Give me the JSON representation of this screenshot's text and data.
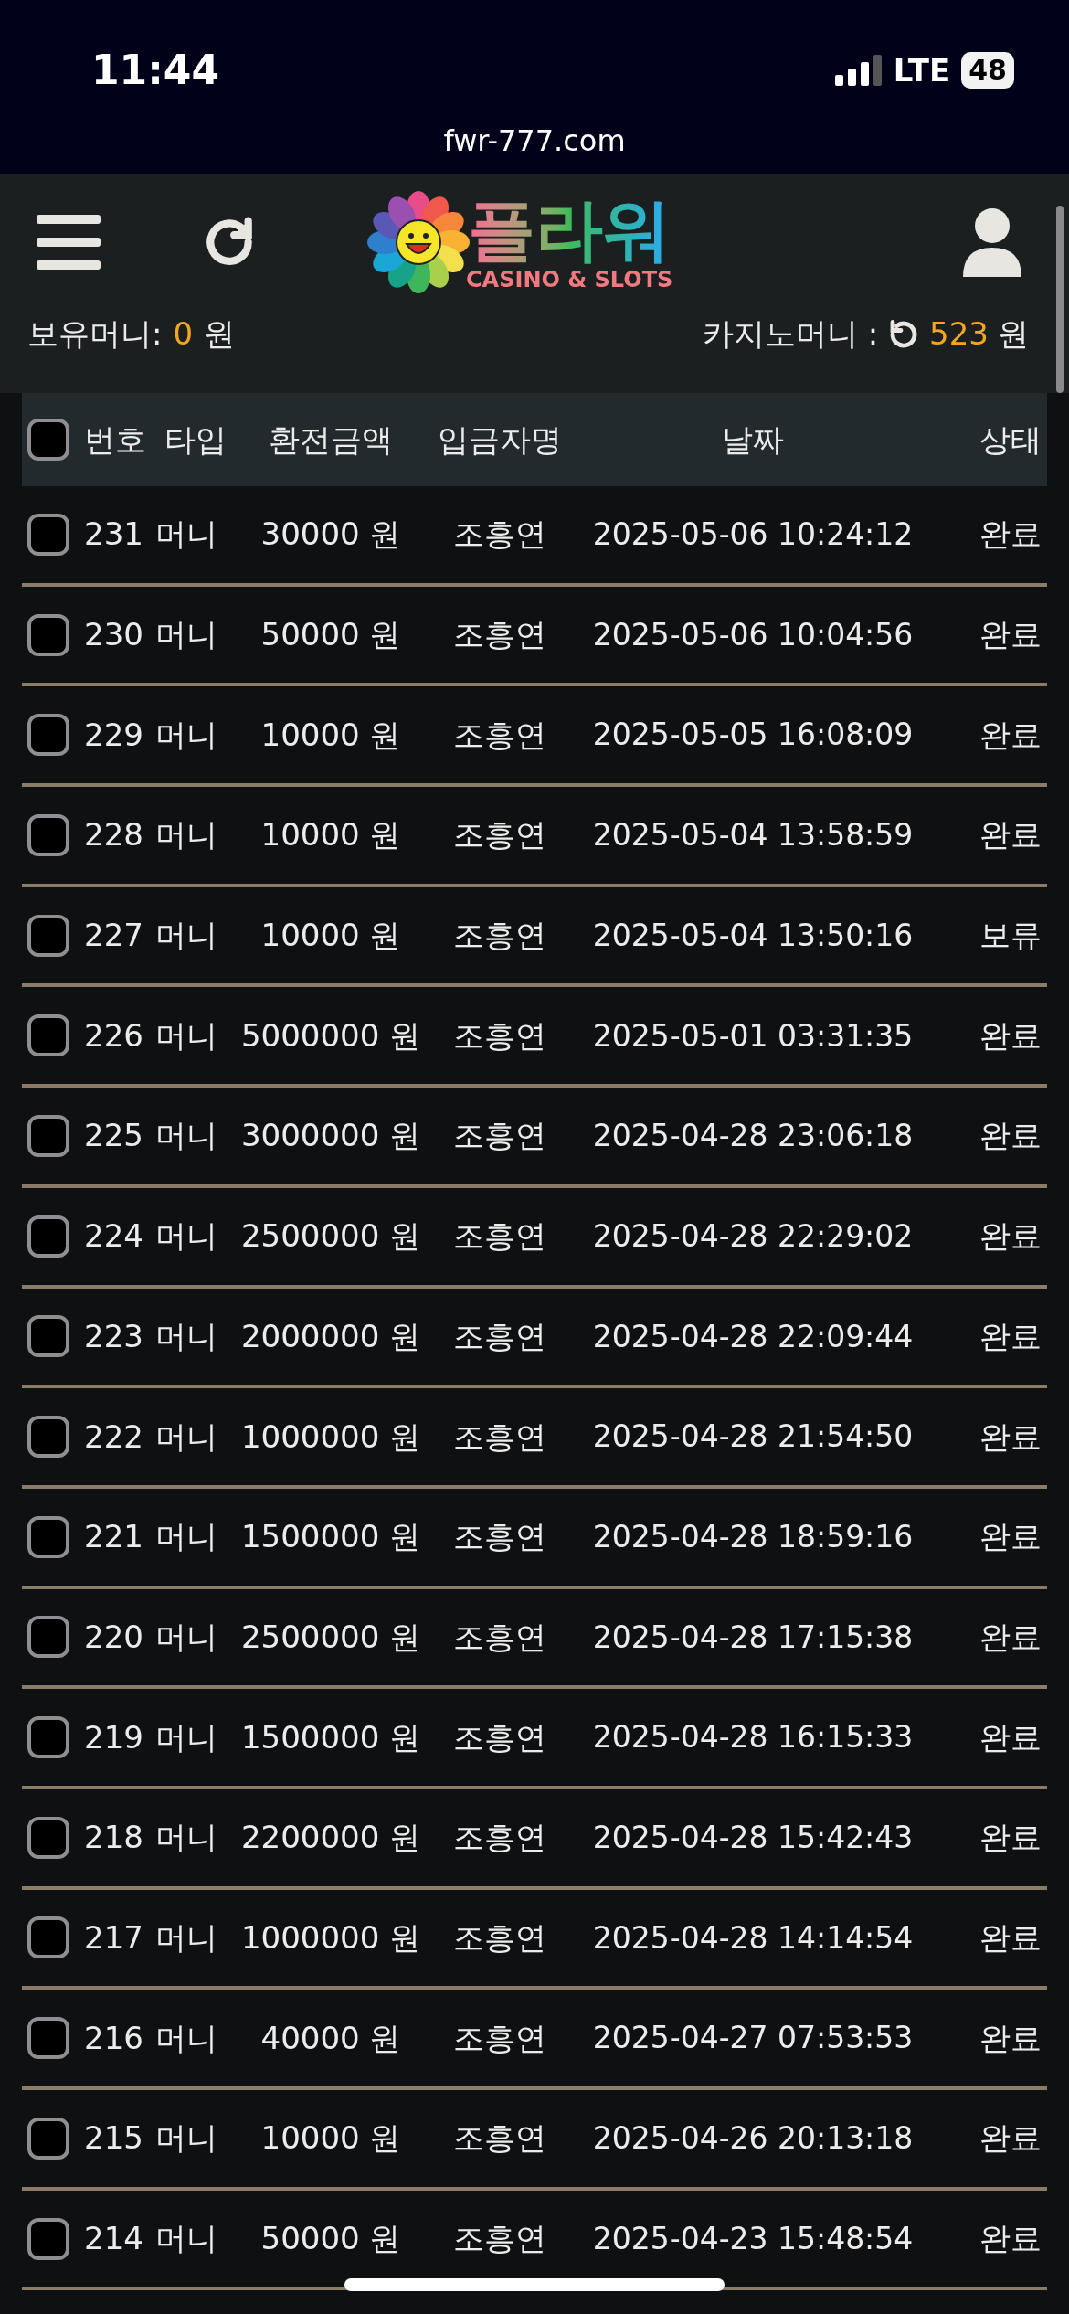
{
  "status_bar": {
    "time": "11:44",
    "network": "LTE",
    "battery": "48"
  },
  "browser": {
    "url": "fwr-777.com"
  },
  "header": {
    "logo_title": "플라워",
    "logo_subtitle": "CASINO & SLOTS"
  },
  "balances": {
    "held_label": "보유머니:",
    "held_value": "0",
    "held_unit": "원",
    "casino_label": "카지노머니 :",
    "casino_value": "523",
    "casino_unit": "원"
  },
  "table": {
    "select_all": {
      "checked": false
    },
    "columns": [
      "번호",
      "타입",
      "환전금액",
      "입금자명",
      "날짜",
      "상태"
    ],
    "rows": [
      {
        "number": "231",
        "type": "머니",
        "amount": "30000 원",
        "name": "조흥연",
        "date": "2025-05-06 10:24:12",
        "status": "완료",
        "checked": false
      },
      {
        "number": "230",
        "type": "머니",
        "amount": "50000 원",
        "name": "조흥연",
        "date": "2025-05-06 10:04:56",
        "status": "완료",
        "checked": false
      },
      {
        "number": "229",
        "type": "머니",
        "amount": "10000 원",
        "name": "조흥연",
        "date": "2025-05-05 16:08:09",
        "status": "완료",
        "checked": false
      },
      {
        "number": "228",
        "type": "머니",
        "amount": "10000 원",
        "name": "조흥연",
        "date": "2025-05-04 13:58:59",
        "status": "완료",
        "checked": false
      },
      {
        "number": "227",
        "type": "머니",
        "amount": "10000 원",
        "name": "조흥연",
        "date": "2025-05-04 13:50:16",
        "status": "보류",
        "checked": false
      },
      {
        "number": "226",
        "type": "머니",
        "amount": "5000000 원",
        "name": "조흥연",
        "date": "2025-05-01 03:31:35",
        "status": "완료",
        "checked": false
      },
      {
        "number": "225",
        "type": "머니",
        "amount": "3000000 원",
        "name": "조흥연",
        "date": "2025-04-28 23:06:18",
        "status": "완료",
        "checked": false
      },
      {
        "number": "224",
        "type": "머니",
        "amount": "2500000 원",
        "name": "조흥연",
        "date": "2025-04-28 22:29:02",
        "status": "완료",
        "checked": false
      },
      {
        "number": "223",
        "type": "머니",
        "amount": "2000000 원",
        "name": "조흥연",
        "date": "2025-04-28 22:09:44",
        "status": "완료",
        "checked": false
      },
      {
        "number": "222",
        "type": "머니",
        "amount": "1000000 원",
        "name": "조흥연",
        "date": "2025-04-28 21:54:50",
        "status": "완료",
        "checked": false
      },
      {
        "number": "221",
        "type": "머니",
        "amount": "1500000 원",
        "name": "조흥연",
        "date": "2025-04-28 18:59:16",
        "status": "완료",
        "checked": false
      },
      {
        "number": "220",
        "type": "머니",
        "amount": "2500000 원",
        "name": "조흥연",
        "date": "2025-04-28 17:15:38",
        "status": "완료",
        "checked": false
      },
      {
        "number": "219",
        "type": "머니",
        "amount": "1500000 원",
        "name": "조흥연",
        "date": "2025-04-28 16:15:33",
        "status": "완료",
        "checked": false
      },
      {
        "number": "218",
        "type": "머니",
        "amount": "2200000 원",
        "name": "조흥연",
        "date": "2025-04-28 15:42:43",
        "status": "완료",
        "checked": false
      },
      {
        "number": "217",
        "type": "머니",
        "amount": "1000000 원",
        "name": "조흥연",
        "date": "2025-04-28 14:14:54",
        "status": "완료",
        "checked": false
      },
      {
        "number": "216",
        "type": "머니",
        "amount": "40000 원",
        "name": "조흥연",
        "date": "2025-04-27 07:53:53",
        "status": "완료",
        "checked": false
      },
      {
        "number": "215",
        "type": "머니",
        "amount": "10000 원",
        "name": "조흥연",
        "date": "2025-04-26 20:13:18",
        "status": "완료",
        "checked": false
      },
      {
        "number": "214",
        "type": "머니",
        "amount": "50000 원",
        "name": "조흥연",
        "date": "2025-04-23 15:48:54",
        "status": "완료",
        "checked": false
      }
    ]
  }
}
